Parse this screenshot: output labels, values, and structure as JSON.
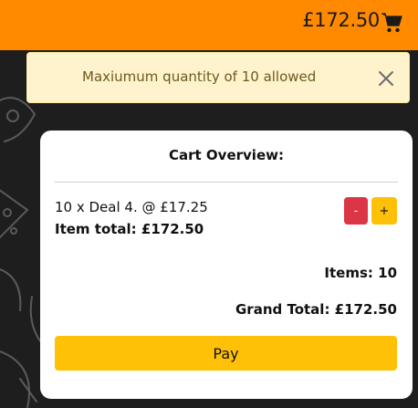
{
  "header": {
    "cart_total": "£172.50",
    "cart_icon": "shopping-cart-icon"
  },
  "alert": {
    "message": "Maxiumum quantity of 10 allowed",
    "close_icon": "close-icon"
  },
  "cart": {
    "title": "Cart Overview:",
    "items": [
      {
        "line": "10 x Deal 4. @ £17.25",
        "total": "Item total: £172.50",
        "decrease_label": "-",
        "increase_label": "+"
      }
    ],
    "items_count": "Items: 10",
    "grand_total": "Grand Total: £172.50",
    "pay_label": "Pay"
  },
  "colors": {
    "topbar": "#ff8a00",
    "alert_bg": "#fff3cd",
    "alert_text": "#6b5a1e",
    "danger": "#dc3545",
    "warning": "#ffc107",
    "background": "#1e1e1e"
  }
}
